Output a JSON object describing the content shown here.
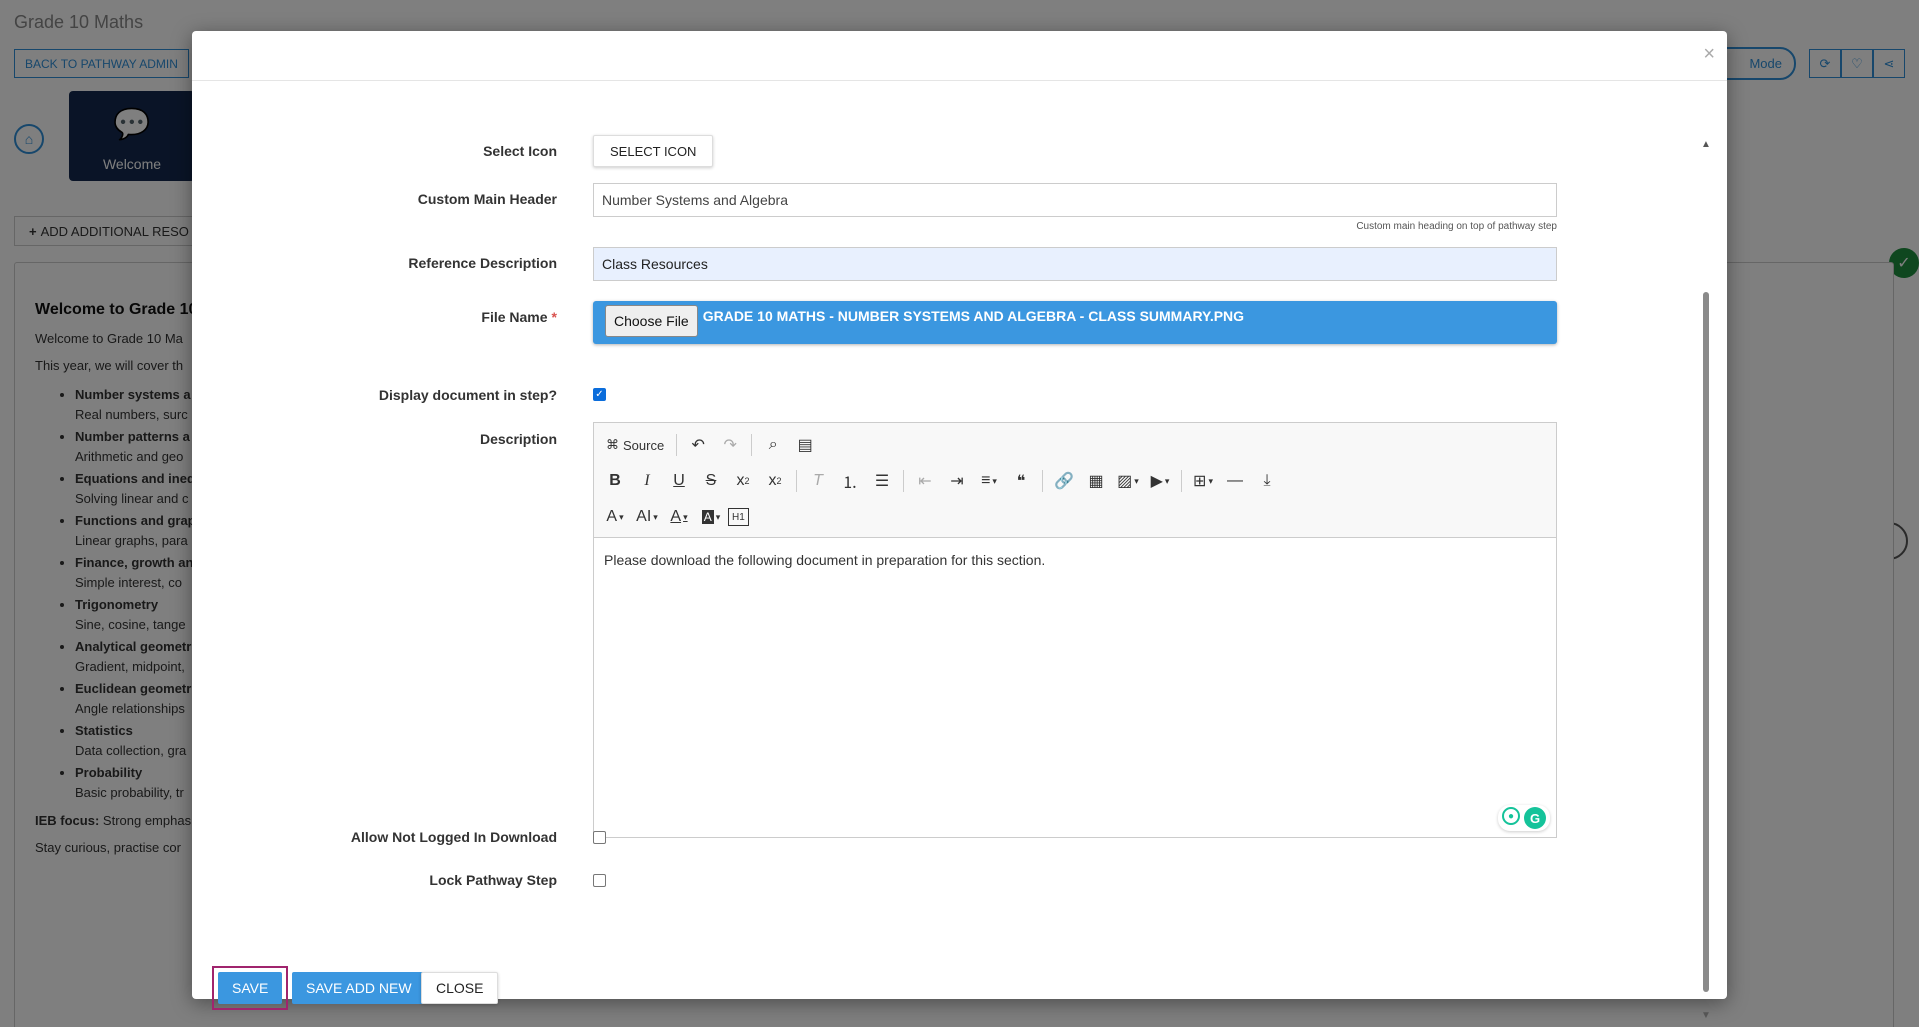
{
  "background": {
    "page_title": "Grade 10 Maths",
    "back_button": "BACK TO PATHWAY ADMIN",
    "mode_button": "Mode",
    "step_label": "Welcome",
    "add_resource": "ADD ADDITIONAL RESO",
    "content_heading": "Welcome to Grade 10",
    "content_intro": "Welcome to Grade 10 Ma",
    "content_cover": "This year, we will cover th",
    "topics": [
      {
        "title": "Number systems a",
        "detail": "Real numbers, surc"
      },
      {
        "title": "Number patterns a",
        "detail": "Arithmetic and geo"
      },
      {
        "title": "Equations and ineq",
        "detail": "Solving linear and c"
      },
      {
        "title": "Functions and grap",
        "detail": "Linear graphs, para"
      },
      {
        "title": "Finance, growth an",
        "detail": "Simple interest, co"
      },
      {
        "title": "Trigonometry",
        "detail": "Sine, cosine, tange"
      },
      {
        "title": "Analytical geometr",
        "detail": "Gradient, midpoint,"
      },
      {
        "title": "Euclidean geometr",
        "detail": "Angle relationships"
      },
      {
        "title": "Statistics",
        "detail": "Data collection, gra"
      },
      {
        "title": "Probability",
        "detail": "Basic probability, tr"
      }
    ],
    "ieb_label": "IEB focus:",
    "ieb_text": " Strong emphas",
    "closing": "Stay curious, practise cor"
  },
  "modal": {
    "close_icon": "×",
    "form": {
      "select_icon": {
        "label": "Select Icon",
        "button": "SELECT ICON"
      },
      "custom_main_header": {
        "label": "Custom Main Header",
        "value": "Number Systems and Algebra",
        "help": "Custom main heading on top of pathway step"
      },
      "reference_description": {
        "label": "Reference Description",
        "value": "Class Resources"
      },
      "file_name": {
        "label": "File Name",
        "required": "*",
        "button": "Choose File",
        "value": "GRADE 10 MATHS - NUMBER SYSTEMS AND ALGEBRA - CLASS SUMMARY.PNG"
      },
      "display_document": {
        "label": "Display document in step?",
        "checked": true
      },
      "description": {
        "label": "Description",
        "source_label": "Source",
        "content": "Please download the following document in preparation for this section."
      },
      "allow_not_logged_in": {
        "label": "Allow Not Logged In Download",
        "checked": false
      },
      "lock_pathway_step": {
        "label": "Lock Pathway Step",
        "checked": false
      }
    },
    "buttons": {
      "save": "SAVE",
      "save_add_new": "SAVE ADD NEW",
      "close": "CLOSE"
    }
  }
}
